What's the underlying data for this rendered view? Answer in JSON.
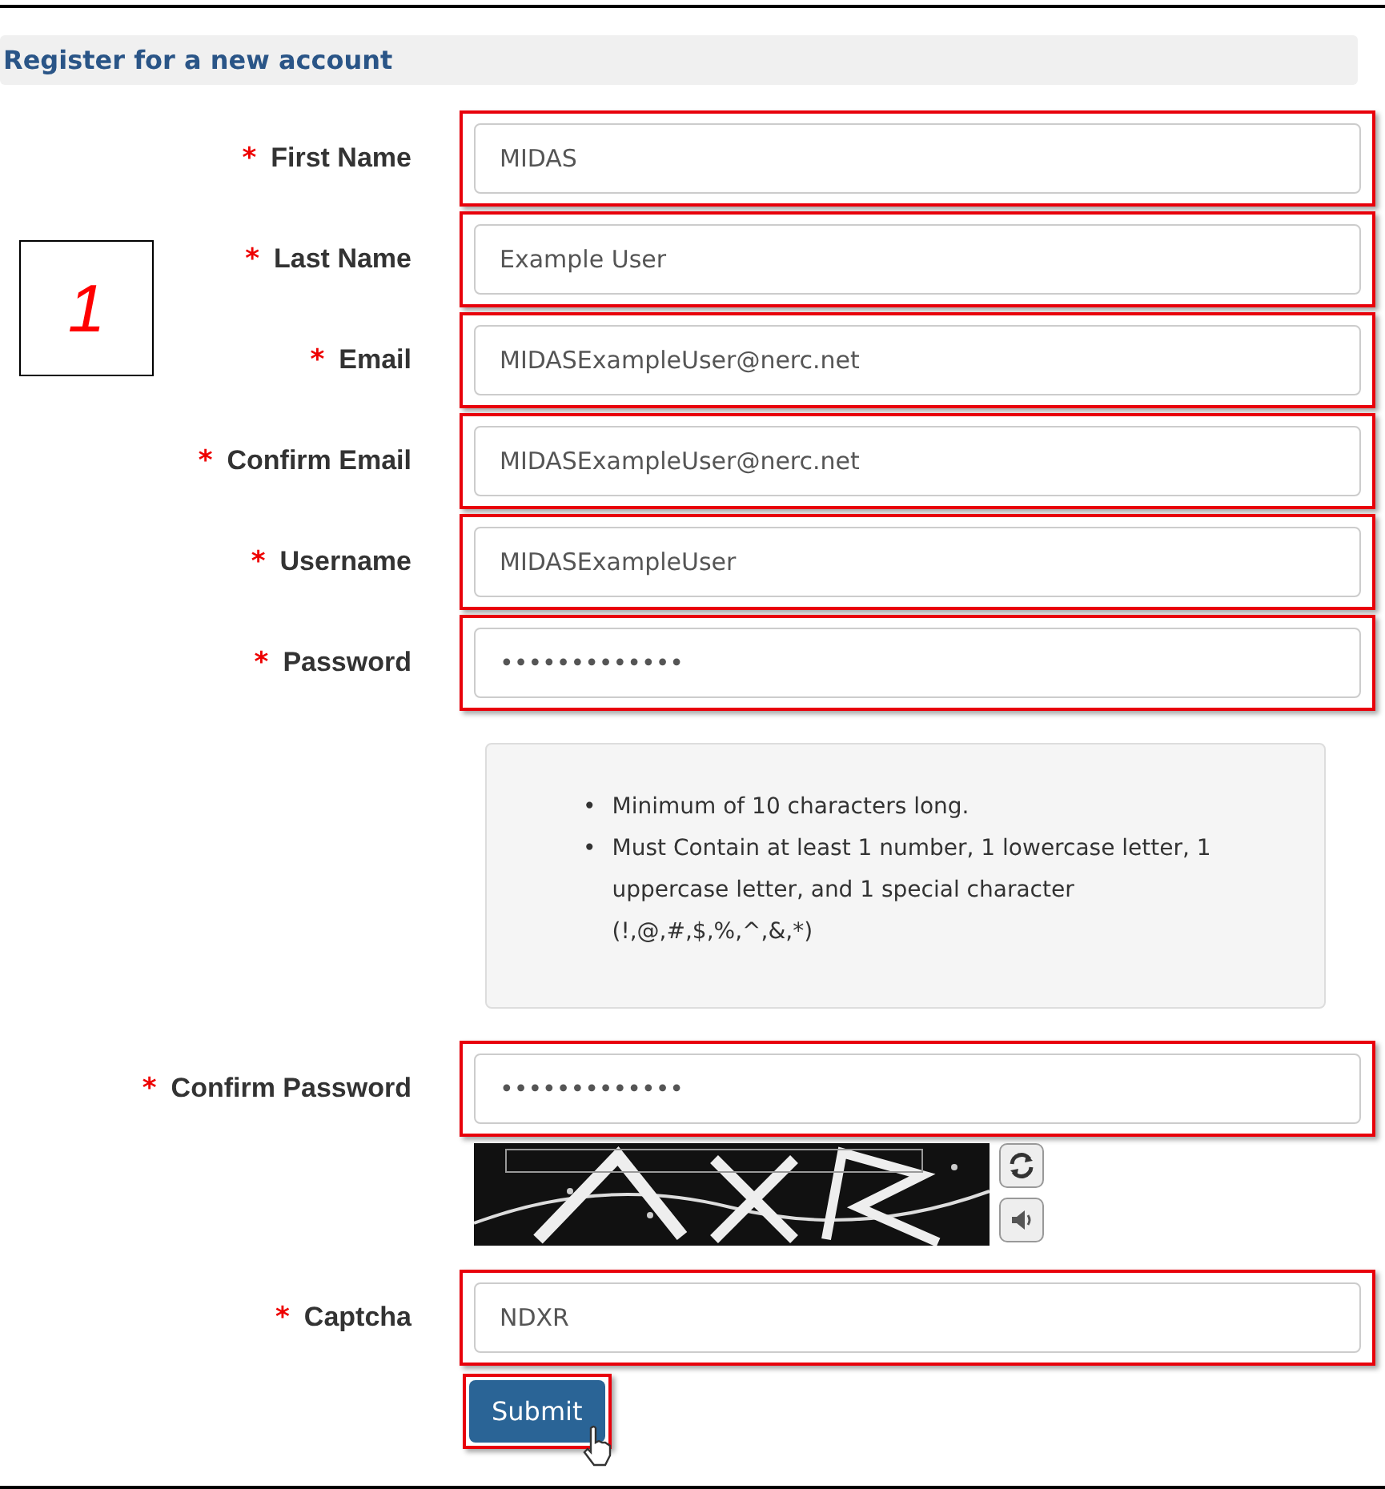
{
  "heading": "Register for a new account",
  "annotation": {
    "label": "1"
  },
  "fields": [
    {
      "label": "First Name",
      "required": "*",
      "value": "MIDAS",
      "highlighted": true
    },
    {
      "label": "Last Name",
      "required": "*",
      "value": "Example User",
      "highlighted": true
    },
    {
      "label": "Email",
      "required": "*",
      "value": "MIDASExampleUser@nerc.net",
      "highlighted": true
    },
    {
      "label": "Confirm Email",
      "required": "*",
      "value": "MIDASExampleUser@nerc.net",
      "highlighted": true
    },
    {
      "label": "Username",
      "required": "*",
      "value": "MIDASExampleUser",
      "highlighted": true
    },
    {
      "label": "Password",
      "required": "*",
      "value": "•••••••••••••",
      "highlighted": true
    }
  ],
  "password_rules": [
    {
      "bullet": "•",
      "text": "Minimum of 10 characters long."
    },
    {
      "bullet": "•",
      "text": "Must Contain at least 1 number, 1 lowercase letter, 1 uppercase letter, and 1 special character (!,@,#,$,%,^,&,*)"
    }
  ],
  "confirm_password": {
    "label": "Confirm Password",
    "required": "*",
    "value": "•••••••••••••",
    "highlighted": true
  },
  "captcha": {
    "label": "Captcha",
    "required": "*",
    "value": "NDXR",
    "highlighted": true
  },
  "submit": {
    "label": "Submit",
    "highlighted": true
  }
}
